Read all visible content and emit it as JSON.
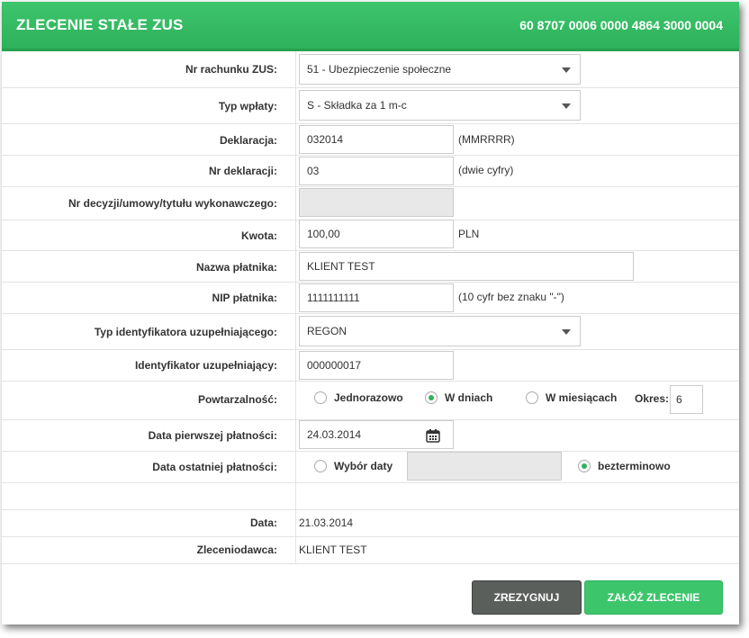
{
  "header": {
    "title": "ZLECENIE STAŁE ZUS",
    "account": "60 8707 0006 0000 4864 3000 0004"
  },
  "form": {
    "account_zus": {
      "label": "Nr rachunku ZUS:",
      "value": "51 - Ubezpieczenie społeczne"
    },
    "payment_type": {
      "label": "Typ wpłaty:",
      "value": "S - Składka za 1 m-c"
    },
    "declaration": {
      "label": "Deklaracja:",
      "value": "032014",
      "hint": "(MMRRRR)"
    },
    "declaration_no": {
      "label": "Nr deklaracji:",
      "value": "03",
      "hint": "(dwie cyfry)"
    },
    "decision_no": {
      "label": "Nr decyzji/umowy/tytułu wykonawczego:",
      "value": ""
    },
    "amount": {
      "label": "Kwota:",
      "value": "100,00",
      "currency": "PLN"
    },
    "payer_name": {
      "label": "Nazwa płatnika:",
      "value": "KLIENT TEST"
    },
    "payer_nip": {
      "label": "NIP płatnika:",
      "value": "1111111111",
      "hint": "(10 cyfr bez znaku \"-\")"
    },
    "id_type": {
      "label": "Typ identyfikatora uzupełniającego:",
      "value": "REGON"
    },
    "id_value": {
      "label": "Identyfikator uzupełniający:",
      "value": "000000017"
    },
    "recurrence": {
      "label": "Powtarzalność:",
      "options": [
        "Jednorazowo",
        "W dniach",
        "W miesiącach"
      ],
      "selected": "W dniach",
      "period_label": "Okres:",
      "period_value": "6"
    },
    "first_payment": {
      "label": "Data pierwszej płatności:",
      "value": "24.03.2014"
    },
    "last_payment": {
      "label": "Data ostatniej płatności:",
      "option_date": "Wybór daty",
      "option_open": "bezterminowo",
      "selected": "bezterminowo"
    },
    "date": {
      "label": "Data:",
      "value": "21.03.2014"
    },
    "principal": {
      "label": "Zleceniodawca:",
      "value": "KLIENT TEST"
    }
  },
  "buttons": {
    "cancel": "ZREZYGNUJ",
    "submit": "ZAŁÓŻ ZLECENIE"
  },
  "colors": {
    "brand": "#2eb15b",
    "cancel": "#5b5f5c"
  }
}
